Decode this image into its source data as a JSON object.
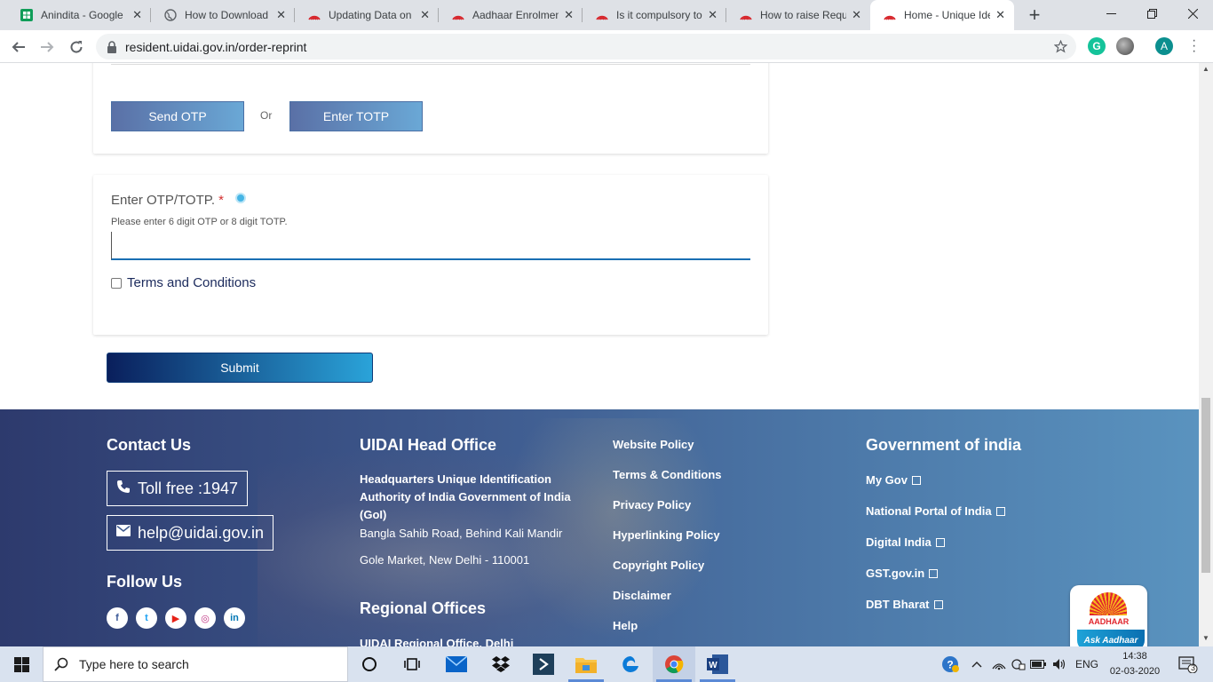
{
  "browser": {
    "tabs": [
      {
        "title": "Anindita - Google",
        "icon": "google-sheets-icon",
        "active": false
      },
      {
        "title": "How to Download",
        "icon": "globe-icon",
        "active": false
      },
      {
        "title": "Updating Data on",
        "icon": "aadhaar-icon",
        "active": false
      },
      {
        "title": "Aadhaar Enrolmen",
        "icon": "aadhaar-icon",
        "active": false
      },
      {
        "title": "Is it compulsory to",
        "icon": "aadhaar-icon",
        "active": false
      },
      {
        "title": "How to raise Requ",
        "icon": "aadhaar-icon",
        "active": false
      },
      {
        "title": "Home - Unique Ide",
        "icon": "aadhaar-icon",
        "active": true
      }
    ],
    "new_tab": "+",
    "url": "resident.uidai.gov.in/order-reprint",
    "profile_initial": "A",
    "colors": {
      "tabbar": "#dee1e6",
      "profile": "#0b8f8f",
      "grammarly": "#15c39a"
    }
  },
  "form": {
    "send_otp_label": "Send OTP",
    "or_label": "Or",
    "enter_totp_label": "Enter TOTP",
    "otp_label": "Enter OTP/TOTP.",
    "required_mark": "*",
    "otp_help": "Please enter 6 digit OTP or 8 digit TOTP.",
    "otp_value": "",
    "terms_label": "Terms and Conditions",
    "terms_checked": false,
    "submit_label": "Submit"
  },
  "footer": {
    "contact": {
      "heading": "Contact Us",
      "toll_free": "Toll free :1947",
      "email": "help@uidai.gov.in",
      "follow_heading": "Follow Us",
      "social": [
        "f",
        "t",
        "▶",
        "◎",
        "in"
      ]
    },
    "head_office": {
      "heading": "UIDAI Head Office",
      "name_line": "Headquarters Unique Identification Authority of India Government of India (GoI)",
      "address1": "Bangla Sahib Road, Behind Kali Mandir",
      "address2": "Gole Market, New Delhi - 110001",
      "regional_heading": "Regional Offices",
      "regional_first": "UIDAI Regional Office, Delhi"
    },
    "policies": [
      "Website Policy",
      "Terms & Conditions",
      "Privacy Policy",
      "Hyperlinking Policy",
      "Copyright Policy",
      "Disclaimer",
      "Help"
    ],
    "government": {
      "heading": "Government of india",
      "links": [
        "My Gov",
        "National Portal of India",
        "Digital India",
        "GST.gov.in",
        "DBT Bharat"
      ]
    },
    "ask_aadhaar": {
      "logo_text": "AADHAAR",
      "bubble_text": "Ask Aadhaar"
    }
  },
  "taskbar": {
    "search_placeholder": "Type here to search",
    "language": "ENG",
    "time": "14:38",
    "date": "02-03-2020",
    "notifications": "3",
    "apps": [
      "cortana-icon",
      "task-view-icon",
      "mail-icon",
      "dropbox-icon",
      "visual-studio-icon",
      "file-explorer-icon",
      "edge-icon",
      "chrome-icon",
      "word-icon"
    ]
  }
}
